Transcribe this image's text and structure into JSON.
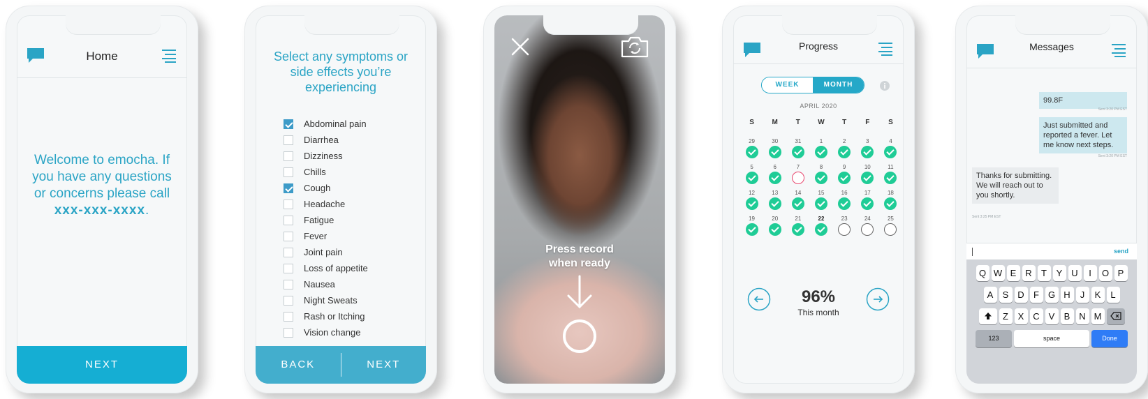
{
  "screens": {
    "home": {
      "title": "Home",
      "welcome_text": "Welcome to emocha. If you have any questions or concerns please call",
      "phone": "xxx-xxx-xxxx",
      "punct": ".",
      "next_label": "NEXT"
    },
    "symptoms": {
      "title": "Select any symptoms or side effects you’re experiencing",
      "items": [
        {
          "label": "Abdominal pain",
          "checked": true
        },
        {
          "label": "Diarrhea",
          "checked": false
        },
        {
          "label": "Dizziness",
          "checked": false
        },
        {
          "label": "Chills",
          "checked": false
        },
        {
          "label": "Cough",
          "checked": true
        },
        {
          "label": "Headache",
          "checked": false
        },
        {
          "label": "Fatigue",
          "checked": false
        },
        {
          "label": "Fever",
          "checked": false
        },
        {
          "label": "Joint pain",
          "checked": false
        },
        {
          "label": "Loss of appetite",
          "checked": false
        },
        {
          "label": "Nausea",
          "checked": false
        },
        {
          "label": "Night Sweats",
          "checked": false
        },
        {
          "label": "Rash or Itching",
          "checked": false
        },
        {
          "label": "Vision change",
          "checked": false
        }
      ],
      "back_label": "BACK",
      "next_label": "NEXT"
    },
    "record": {
      "prompt_line1": "Press record",
      "prompt_line2": "when ready"
    },
    "progress": {
      "title": "Progress",
      "toggle_week": "WEEK",
      "toggle_month": "MONTH",
      "month": "APRIL 2020",
      "weekdays": [
        "S",
        "M",
        "T",
        "W",
        "T",
        "F",
        "S"
      ],
      "days": [
        {
          "n": "29",
          "s": "done"
        },
        {
          "n": "30",
          "s": "done"
        },
        {
          "n": "31",
          "s": "done"
        },
        {
          "n": "1",
          "s": "done"
        },
        {
          "n": "2",
          "s": "done"
        },
        {
          "n": "3",
          "s": "done"
        },
        {
          "n": "4",
          "s": "done"
        },
        {
          "n": "5",
          "s": "done"
        },
        {
          "n": "6",
          "s": "done"
        },
        {
          "n": "7",
          "s": "missed"
        },
        {
          "n": "8",
          "s": "done"
        },
        {
          "n": "9",
          "s": "done"
        },
        {
          "n": "10",
          "s": "done"
        },
        {
          "n": "11",
          "s": "done"
        },
        {
          "n": "12",
          "s": "done"
        },
        {
          "n": "13",
          "s": "done"
        },
        {
          "n": "14",
          "s": "done"
        },
        {
          "n": "15",
          "s": "done"
        },
        {
          "n": "16",
          "s": "done"
        },
        {
          "n": "17",
          "s": "done"
        },
        {
          "n": "18",
          "s": "done"
        },
        {
          "n": "19",
          "s": "done"
        },
        {
          "n": "20",
          "s": "done"
        },
        {
          "n": "21",
          "s": "done"
        },
        {
          "n": "22",
          "s": "done",
          "today": true
        },
        {
          "n": "23",
          "s": "pending"
        },
        {
          "n": "24",
          "s": "pending"
        },
        {
          "n": "25",
          "s": "pending"
        }
      ],
      "percent": "96%",
      "percent_label": "This month"
    },
    "messages": {
      "title": "Messages",
      "items": [
        {
          "dir": "out",
          "text": "99.8F",
          "stamp": "Sent 3:20 PM EST"
        },
        {
          "dir": "out",
          "text": "Just submitted and reported a fever. Let me know next steps.",
          "stamp": "Sent 3:20 PM EST"
        },
        {
          "dir": "in",
          "text": "Thanks for submitting. We will reach out to you shortly.",
          "stamp": "Sent 3:25 PM EST"
        }
      ],
      "send_label": "send",
      "keyboard": {
        "row1": [
          "Q",
          "W",
          "E",
          "R",
          "T",
          "Y",
          "U",
          "I",
          "O",
          "P"
        ],
        "row2": [
          "A",
          "S",
          "D",
          "F",
          "G",
          "H",
          "J",
          "K",
          "L"
        ],
        "row3": [
          "Z",
          "X",
          "C",
          "V",
          "B",
          "N",
          "M"
        ],
        "k123": "123",
        "space": "space",
        "done": "Done"
      }
    }
  },
  "colors": {
    "accent": "#15aed3",
    "check_green": "#1fcc96",
    "missed_red": "#e8476e",
    "done_blue": "#2f7cf6"
  }
}
